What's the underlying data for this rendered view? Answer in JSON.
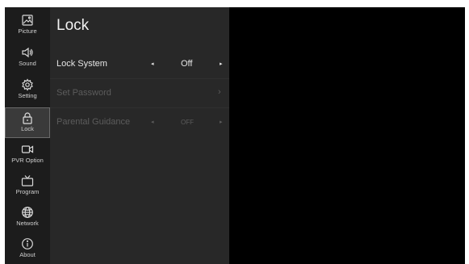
{
  "sidebar": {
    "items": [
      {
        "label": "Picture",
        "icon": "picture-icon",
        "active": false
      },
      {
        "label": "Sound",
        "icon": "speaker-icon",
        "active": false
      },
      {
        "label": "Setting",
        "icon": "gear-icon",
        "active": false
      },
      {
        "label": "Lock",
        "icon": "lock-icon",
        "active": true
      },
      {
        "label": "PVR Option",
        "icon": "video-camera-icon",
        "active": false
      },
      {
        "label": "Program",
        "icon": "tv-icon",
        "active": false
      },
      {
        "label": "Network",
        "icon": "globe-icon",
        "active": false
      },
      {
        "label": "About",
        "icon": "info-icon",
        "active": false
      }
    ]
  },
  "panel": {
    "title": "Lock",
    "rows": [
      {
        "label": "Lock System",
        "value": "Off",
        "left_arrow": "◂",
        "right_arrow": "▸",
        "enabled": true
      },
      {
        "label": "Set Password",
        "chevron": "›",
        "enabled": false
      },
      {
        "label": "Parental Guidance",
        "value": "OFF",
        "left_arrow": "◂",
        "right_arrow": "▸",
        "enabled": false
      }
    ]
  },
  "colors": {
    "rail_bg": "#1c1c1c",
    "panel_bg": "#282828",
    "screen_bg": "#000000",
    "text_enabled": "#e6e6e6",
    "text_disabled": "#5c5c5c"
  }
}
